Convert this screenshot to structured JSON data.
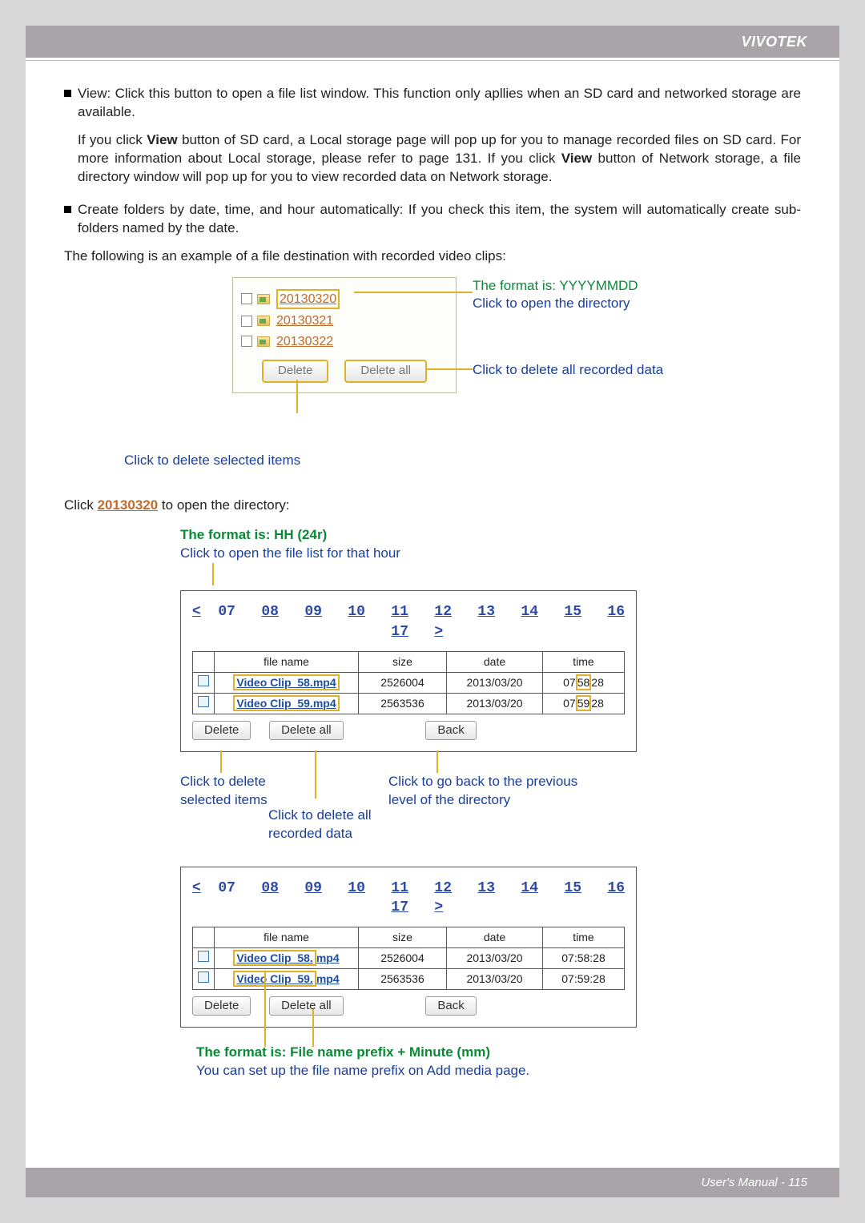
{
  "header": {
    "brand": "VIVOTEK"
  },
  "section": {
    "bullet1_part1": "View: Click this button to open a file list window. This function only apllies when an SD card and networked storage are available.",
    "bullet1_part2a": "If you click ",
    "bullet1_view": "View",
    "bullet1_part2b": " button of SD card, a Local storage page will pop up for you to manage recorded files on SD card. For more information about Local storage, please refer to page 131. If you click ",
    "bullet1_part2c": " button of Network storage, a file directory window will pop up for you to view recorded data on Network storage.",
    "bullet2": "Create folders by date, time, and hour automatically: If you check this item, the system will automatically create sub-folders named by the date.",
    "intro": "The following is an example of a file destination with recorded video clips:"
  },
  "fig1": {
    "folders": [
      "20130320",
      "20130321",
      "20130322"
    ],
    "delete": "Delete",
    "delete_all": "Delete all",
    "ann_format": "The format is: YYYYMMDD",
    "ann_open": "Click to open the directory",
    "ann_delall": "Click to delete all recorded data",
    "ann_delsel": "Click to delete selected items"
  },
  "open_line_a": "Click ",
  "open_folder": "20130320",
  "open_line_b": " to open the directory:",
  "fig2": {
    "title_format": "The format is: HH (24r)",
    "title_action": "Click to open the file list for that hour",
    "hours_prev": "<",
    "hours": [
      "07",
      "08",
      "09",
      "10",
      "11",
      "12",
      "13",
      "14",
      "15",
      "16",
      "17"
    ],
    "hours_next": ">",
    "cols": {
      "fn": "file name",
      "size": "size",
      "date": "date",
      "time": "time"
    },
    "rows": [
      {
        "fn": "Video Clip_58.mp4",
        "size": "2526004",
        "date": "2013/03/20",
        "time_h": "07",
        "time_m": "58",
        "time_s": "28"
      },
      {
        "fn": "Video Clip_59.mp4",
        "size": "2563536",
        "date": "2013/03/20",
        "time_h": "07",
        "time_m": "59",
        "time_s": "28"
      }
    ],
    "delete": "Delete",
    "delete_all": "Delete all",
    "back": "Back",
    "ann_delsel": "Click to delete\nselected items",
    "ann_delall": "Click to delete all\nrecorded data",
    "ann_back": "Click to go back to the previous\nlevel of the directory"
  },
  "fig3": {
    "hours_prev": "<",
    "hours": [
      "07",
      "08",
      "09",
      "10",
      "11",
      "12",
      "13",
      "14",
      "15",
      "16",
      "17"
    ],
    "hours_next": ">",
    "cols": {
      "fn": "file name",
      "size": "size",
      "date": "date",
      "time": "time"
    },
    "rows": [
      {
        "fn_a": "Video Clip_58.",
        "fn_b": "mp4",
        "size": "2526004",
        "date": "2013/03/20",
        "time": "07:58:28"
      },
      {
        "fn_a": "Video Clip_59.",
        "fn_b": "mp4",
        "size": "2563536",
        "date": "2013/03/20",
        "time": "07:59:28"
      }
    ],
    "delete": "Delete",
    "delete_all": "Delete all",
    "back": "Back",
    "foot_format": "The format is: File name prefix + Minute (mm)",
    "foot_note": "You can set up the file name prefix on Add media page."
  },
  "footer": {
    "text": "User's Manual - 115"
  }
}
